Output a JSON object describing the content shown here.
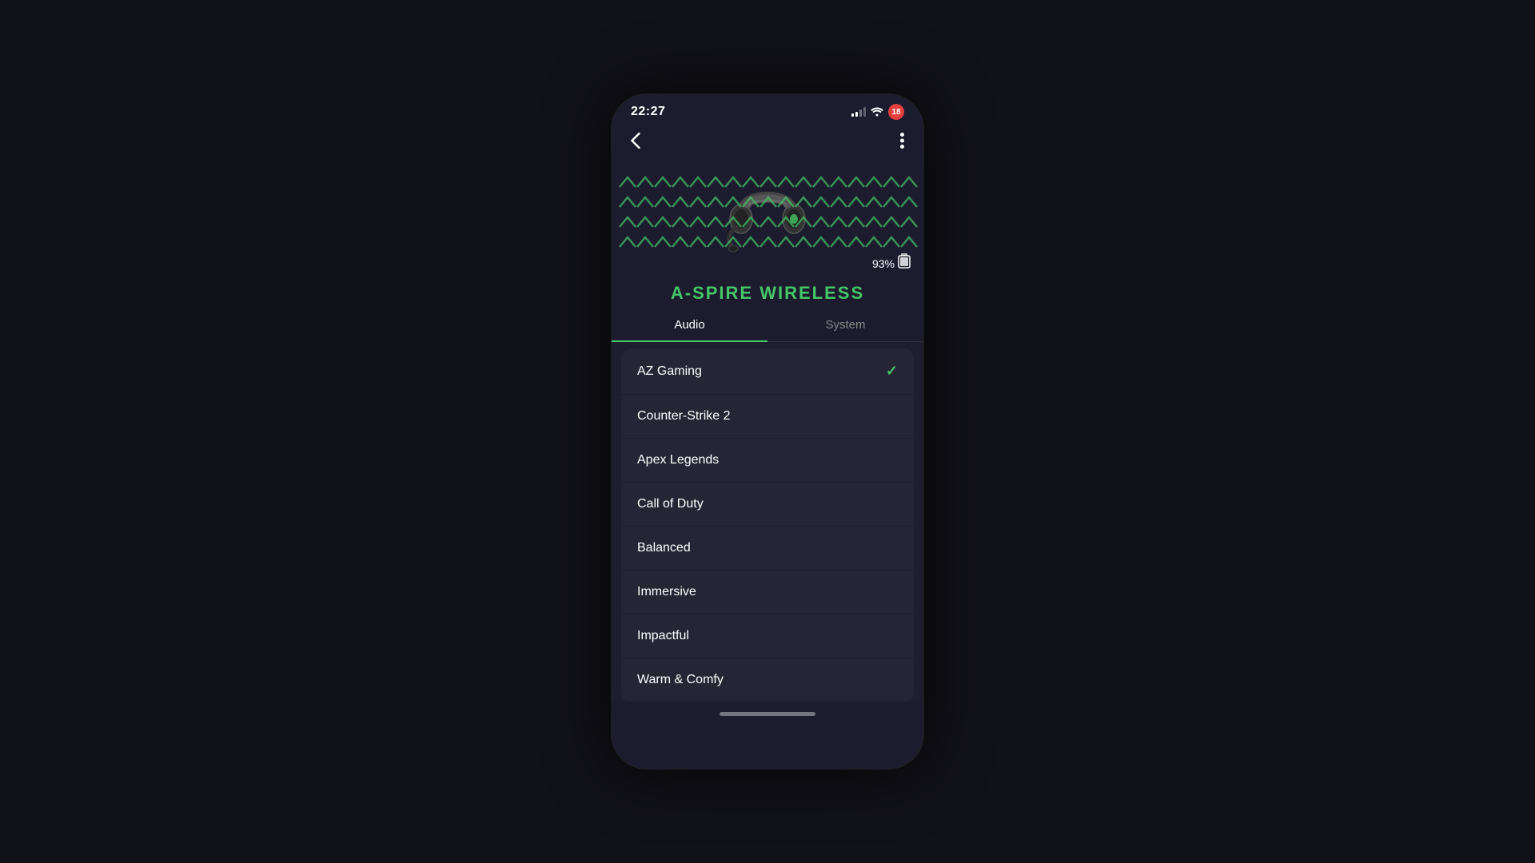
{
  "statusBar": {
    "time": "22:27",
    "notificationCount": "18"
  },
  "header": {
    "backLabel": "‹",
    "moreLabel": "⋮"
  },
  "device": {
    "name": "A-SPIRE WIRELESS",
    "batteryPercent": "93%"
  },
  "tabs": [
    {
      "id": "audio",
      "label": "Audio",
      "active": true
    },
    {
      "id": "system",
      "label": "System",
      "active": false
    }
  ],
  "audioProfiles": [
    {
      "id": "az-gaming",
      "label": "AZ Gaming",
      "selected": true
    },
    {
      "id": "counter-strike-2",
      "label": "Counter-Strike 2",
      "selected": false
    },
    {
      "id": "apex-legends",
      "label": "Apex Legends",
      "selected": false
    },
    {
      "id": "call-of-duty",
      "label": "Call of Duty",
      "selected": false
    },
    {
      "id": "balanced",
      "label": "Balanced",
      "selected": false
    },
    {
      "id": "immersive",
      "label": "Immersive",
      "selected": false
    },
    {
      "id": "impactful",
      "label": "Impactful",
      "selected": false
    },
    {
      "id": "warm-comfy",
      "label": "Warm & Comfy",
      "selected": false
    }
  ],
  "colors": {
    "accent": "#44c767",
    "background": "#1c1c2e",
    "listBackground": "#252535",
    "text": "#ffffff",
    "textMuted": "#888888"
  },
  "homeIndicator": {
    "visible": true
  }
}
